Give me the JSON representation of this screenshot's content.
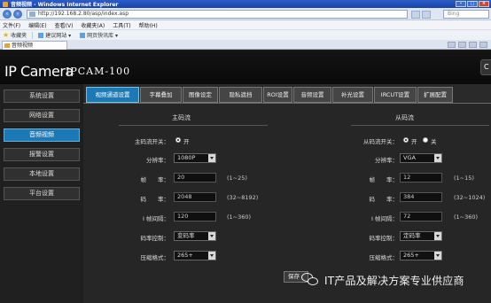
{
  "browser": {
    "window_title": "音频视频 - Windows Internet Explorer",
    "address": "http://192.168.2.80/asp/index.asp",
    "search_placeholder": "Bing",
    "menu": [
      "文件(F)",
      "编辑(E)",
      "查看(V)",
      "收藏夹(A)",
      "工具(T)",
      "帮助(H)"
    ],
    "favorites_label": "收藏夹",
    "favorites": [
      "建议网站 ▾",
      "网页快讯库 ▾"
    ],
    "tab_title": "音频视频"
  },
  "app": {
    "brand": "IP Camera",
    "model": "IPCAM-100",
    "corner_button": "C"
  },
  "sidebar": {
    "items": [
      {
        "label": "系统设置",
        "active": false
      },
      {
        "label": "网络设置",
        "active": false
      },
      {
        "label": "音频视频",
        "active": true
      },
      {
        "label": "报警设置",
        "active": false
      },
      {
        "label": "本地设置",
        "active": false
      },
      {
        "label": "平台设置",
        "active": false
      }
    ]
  },
  "tabs": [
    {
      "label": "视频通道设置",
      "active": true
    },
    {
      "label": "字幕叠加",
      "active": false
    },
    {
      "label": "图像设定",
      "active": false
    },
    {
      "label": "隐私遮挡",
      "active": false
    },
    {
      "label": "ROI设置",
      "active": false
    },
    {
      "label": "音频设置",
      "active": false
    },
    {
      "label": "补光设置",
      "active": false
    },
    {
      "label": "IRCUT设置",
      "active": false
    },
    {
      "label": "扩展配置",
      "active": false
    }
  ],
  "main_stream": {
    "title": "主码流",
    "switch_label": "主码流开关：",
    "switch_on_label": "开",
    "resolution_label": "分辨率：",
    "resolution": "1080P",
    "fps_label": "帧　　率：",
    "fps": "20",
    "fps_range": "(1~25)",
    "bitrate_label": "码　　率：",
    "bitrate": "2048",
    "bitrate_range": "(32~8192)",
    "iframe_label": "I 帧间隔：",
    "iframe": "120",
    "iframe_range": "(1~360)",
    "rate_control_label": "码率控制：",
    "rate_control": "变码率",
    "codec_label": "压缩格式：",
    "codec": "265+"
  },
  "sub_stream": {
    "title": "从码流",
    "switch_label": "从码流开关：",
    "switch_on_label": "开",
    "switch_off_label": "关",
    "resolution_label": "分辨率：",
    "resolution": "VGA",
    "fps_label": "帧　　率：",
    "fps": "12",
    "fps_range": "(1~15)",
    "bitrate_label": "码　　率：",
    "bitrate": "384",
    "bitrate_range": "(32~1024)",
    "iframe_label": "I 帧间隔：",
    "iframe": "72",
    "iframe_range": "(1~360)",
    "rate_control_label": "码率控制：",
    "rate_control": "定码率",
    "codec_label": "压缩格式：",
    "codec": "265+"
  },
  "save_label": "保存",
  "watermark": "IT产品及解决方案专业供应商"
}
